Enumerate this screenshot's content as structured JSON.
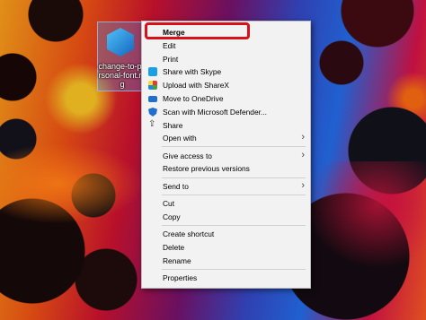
{
  "desktop_icon": {
    "label": "change-to-personal-font.reg"
  },
  "context_menu": {
    "merge": "Merge",
    "edit": "Edit",
    "print": "Print",
    "share_skype": "Share with Skype",
    "upload_sharex": "Upload with ShareX",
    "move_onedrive": "Move to OneDrive",
    "scan_defender": "Scan with Microsoft Defender...",
    "share": "Share",
    "open_with": "Open with",
    "give_access": "Give access to",
    "restore_versions": "Restore previous versions",
    "send_to": "Send to",
    "cut": "Cut",
    "copy": "Copy",
    "create_shortcut": "Create shortcut",
    "delete": "Delete",
    "rename": "Rename",
    "properties": "Properties"
  },
  "icons": {
    "skype": "skype-icon",
    "sharex": "sharex-icon",
    "onedrive": "onedrive-icon",
    "defender": "defender-shield-icon",
    "share": "share-icon",
    "submenu": "chevron-right-icon"
  },
  "colors": {
    "highlight": "#d8101a",
    "menu_background": "#f2f2f2"
  }
}
